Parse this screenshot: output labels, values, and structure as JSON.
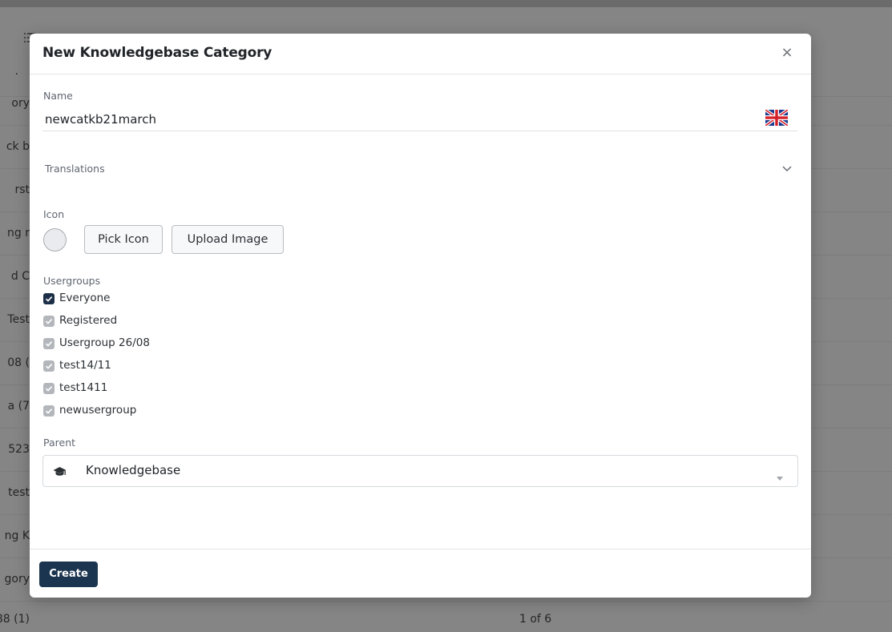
{
  "background": {
    "menu_icon": "list-icon",
    "row_texts": [
      "ory",
      "ck b",
      "rst",
      "ng r",
      "d C",
      "Test",
      "08 (",
      "a (7",
      "523",
      "test",
      "ng K",
      "gory"
    ],
    "footer_left": "88 (1)",
    "pagination": "1 of 6"
  },
  "modal": {
    "title": "New Knowledgebase Category",
    "close_glyph": "×",
    "name": {
      "label": "Name",
      "value": "newcatkb21march",
      "flag": "uk-flag-icon"
    },
    "translations": {
      "label": "Translations"
    },
    "icon_section": {
      "label": "Icon",
      "pick_label": "Pick Icon",
      "upload_label": "Upload Image"
    },
    "usergroups": {
      "label": "Usergroups",
      "items": [
        {
          "label": "Everyone",
          "checked": true,
          "disabled": false
        },
        {
          "label": "Registered",
          "checked": true,
          "disabled": true
        },
        {
          "label": "Usergroup 26/08",
          "checked": true,
          "disabled": true
        },
        {
          "label": "test14/11",
          "checked": true,
          "disabled": true
        },
        {
          "label": "test1411",
          "checked": true,
          "disabled": true
        },
        {
          "label": "newusergroup",
          "checked": true,
          "disabled": true
        }
      ]
    },
    "parent": {
      "label": "Parent",
      "value": "Knowledgebase",
      "icon": "graduation-cap-icon"
    },
    "create_label": "Create"
  },
  "colors": {
    "primary": "#1b344f",
    "checkbox_checked": "#1d2f47",
    "checkbox_disabled": "#b3b7bc",
    "overlay": "#858585"
  }
}
